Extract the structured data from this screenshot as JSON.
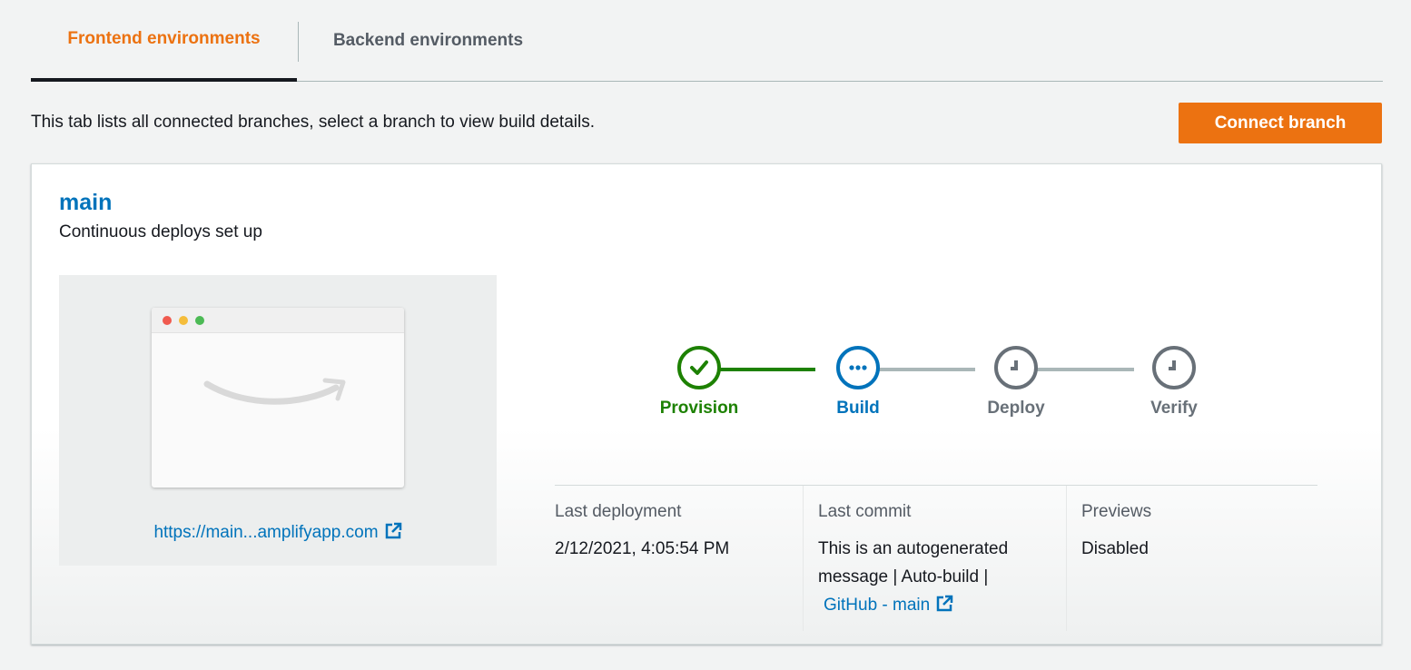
{
  "tabs": [
    {
      "label": "Frontend environments",
      "active": true
    },
    {
      "label": "Backend environments",
      "active": false
    }
  ],
  "description": "This tab lists all connected branches, select a branch to view build details.",
  "connect_button": "Connect branch",
  "branch": {
    "name": "main",
    "subtitle": "Continuous deploys set up",
    "url_text": "https://main...amplifyapp.com",
    "steps": [
      {
        "label": "Provision",
        "status": "complete",
        "icon": "check-icon",
        "color": "#1d8102"
      },
      {
        "label": "Build",
        "status": "in-progress",
        "icon": "ellipsis-icon",
        "color": "#0073bb"
      },
      {
        "label": "Deploy",
        "status": "pending",
        "icon": "clock-icon",
        "color": "#687078"
      },
      {
        "label": "Verify",
        "status": "pending",
        "icon": "clock-icon",
        "color": "#687078"
      }
    ],
    "details": {
      "last_deployment": {
        "key": "Last deployment",
        "value": "2/12/2021, 4:05:54 PM"
      },
      "last_commit": {
        "key": "Last commit",
        "line1": "This is an autogenerated",
        "line2": "message | Auto-build |",
        "link": "GitHub - main"
      },
      "previews": {
        "key": "Previews",
        "value": "Disabled"
      }
    }
  },
  "colors": {
    "accent": "#ec7211",
    "link": "#0073bb",
    "success": "#1d8102",
    "pending": "#687078"
  }
}
